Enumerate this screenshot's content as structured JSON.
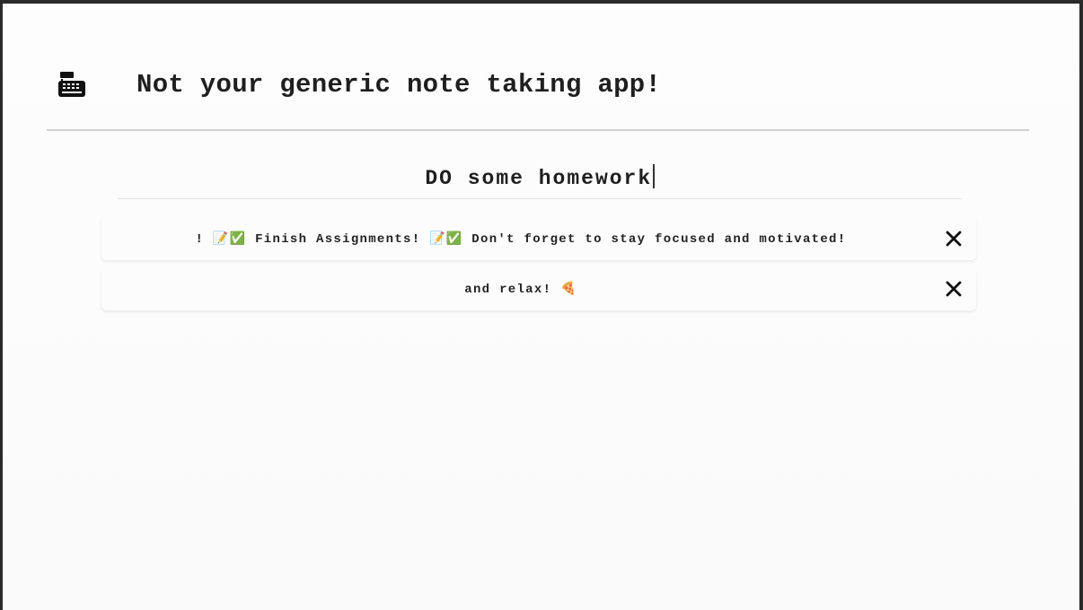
{
  "header": {
    "icon": "cash-register-icon",
    "title": "Not your generic note taking app!"
  },
  "note_editor": {
    "title_value": "DO some homework"
  },
  "notes": [
    {
      "text": "! 📝✅ Finish Assignments! 📝✅ Don't forget to stay focused and motivated!",
      "delete_icon": "close-icon"
    },
    {
      "text": "and relax! 🍕",
      "delete_icon": "close-icon"
    }
  ],
  "colors": {
    "text": "#1f1f1f",
    "rule": "#cfcfcf",
    "background": "#fcfcfc"
  }
}
